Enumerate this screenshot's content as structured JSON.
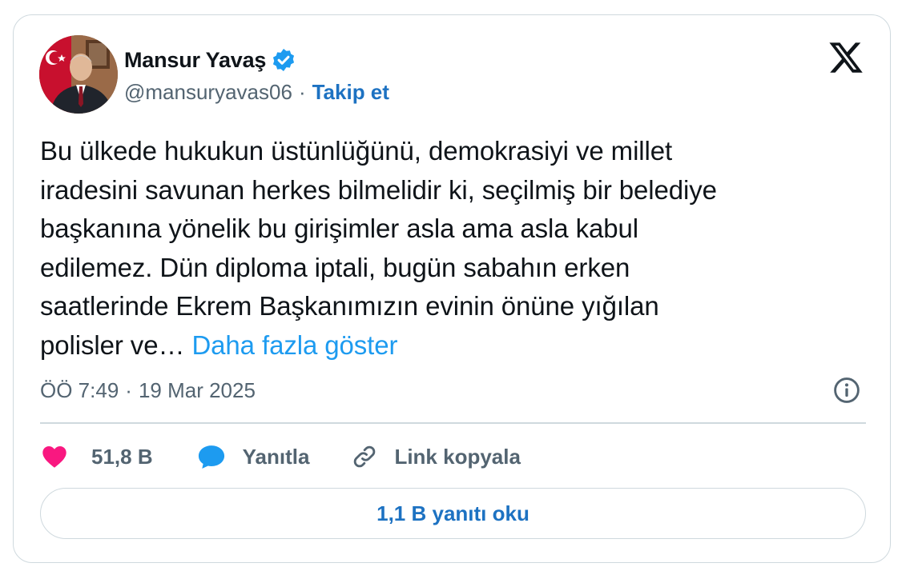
{
  "author": {
    "name": "Mansur Yavaş",
    "handle": "@mansuryavas06",
    "separator": "·",
    "follow_label": "Takip et"
  },
  "tweet": {
    "lines": [
      "Bu ülkede hukukun üstünlüğünü, demokrasiyi ve millet",
      "iradesini savunan herkes bilmelidir ki, seçilmiş bir belediye",
      "başkanına yönelik bu girişimler asla ama asla kabul",
      "edilemez. Dün diploma iptali, bugün sabahın erken",
      "saatlerinde Ekrem Başkanımızın evinin önüne yığılan",
      "polisler ve… "
    ],
    "show_more_label": "Daha fazla göster"
  },
  "meta": {
    "time": "ÖÖ 7:49",
    "separator": "·",
    "date": "19 Mar 2025"
  },
  "actions": {
    "like_count": "51,8 B",
    "reply_label": "Yanıtla",
    "copy_link_label": "Link kopyala"
  },
  "replies_button_label": "1,1 B yanıtı oku",
  "colors": {
    "text": "#0f1419",
    "secondary": "#536471",
    "link": "#1d9bf0",
    "follow": "#1d72c2",
    "like": "#f91880",
    "reply": "#1d9bf0",
    "border": "#cfd9de"
  },
  "icons": {
    "verified": "verified-badge-icon",
    "logo": "x-logo-icon",
    "info": "info-icon",
    "like": "heart-icon",
    "reply": "speech-bubble-icon",
    "copy": "link-icon"
  }
}
